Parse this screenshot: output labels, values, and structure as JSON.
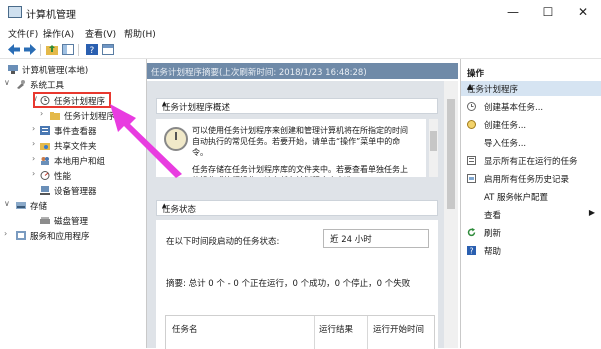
{
  "window": {
    "title": "计算机管理",
    "min": "—",
    "max": "☐",
    "close": "✕"
  },
  "menu": [
    "文件(F)",
    "操作(A)",
    "查看(V)",
    "帮助(H)"
  ],
  "tree": {
    "root": "计算机管理(本地)",
    "system_tools": "系统工具",
    "task_scheduler": "任务计划程序",
    "task_library": "任务计划程序库",
    "event_viewer": "事件查看器",
    "shared_folders": "共享文件夹",
    "local_users": "本地用户和组",
    "performance": "性能",
    "device_manager": "设备管理器",
    "storage": "存储",
    "disk_management": "磁盘管理",
    "services": "服务和应用程序"
  },
  "middle": {
    "summary_header": "任务计划程序摘要(上次刷新时间: 2018/1/23 16:48:28)",
    "overview_title": "任务计划程序概述",
    "overview_text": "可以使用任务计划程序来创建和管理计算机将在所指定的时间自动执行的常见任务。若要开始，请单击“操作”菜单中的命令。",
    "overview_text2": "任务存储在任务计划程序库的文件夹中。若要查看单独任务上的操作或执行操作，请在任务计划程序库中选",
    "task_status_title": "任务状态",
    "status_label": "在以下时间段启动的任务状态:",
    "status_period": "近 24 小时",
    "summary_line": "摘要: 总计 0 个 - 0 个正在运行，0 个成功，0 个停止，0 个失败",
    "columns": [
      "任务名",
      "运行结果",
      "运行开始时间"
    ]
  },
  "actions": {
    "header": "操作",
    "group": "任务计划程序",
    "items": [
      "创建基本任务...",
      "创建任务...",
      "导入任务...",
      "显示所有正在运行的任务",
      "启用所有任务历史记录",
      "AT 服务帐户配置",
      "查看",
      "刷新",
      "帮助"
    ]
  },
  "colors": {
    "accent": "#6f8aa8",
    "selection": "#d6e4f2",
    "annotation": "#e8382f",
    "arrow": "#e83ce0"
  }
}
